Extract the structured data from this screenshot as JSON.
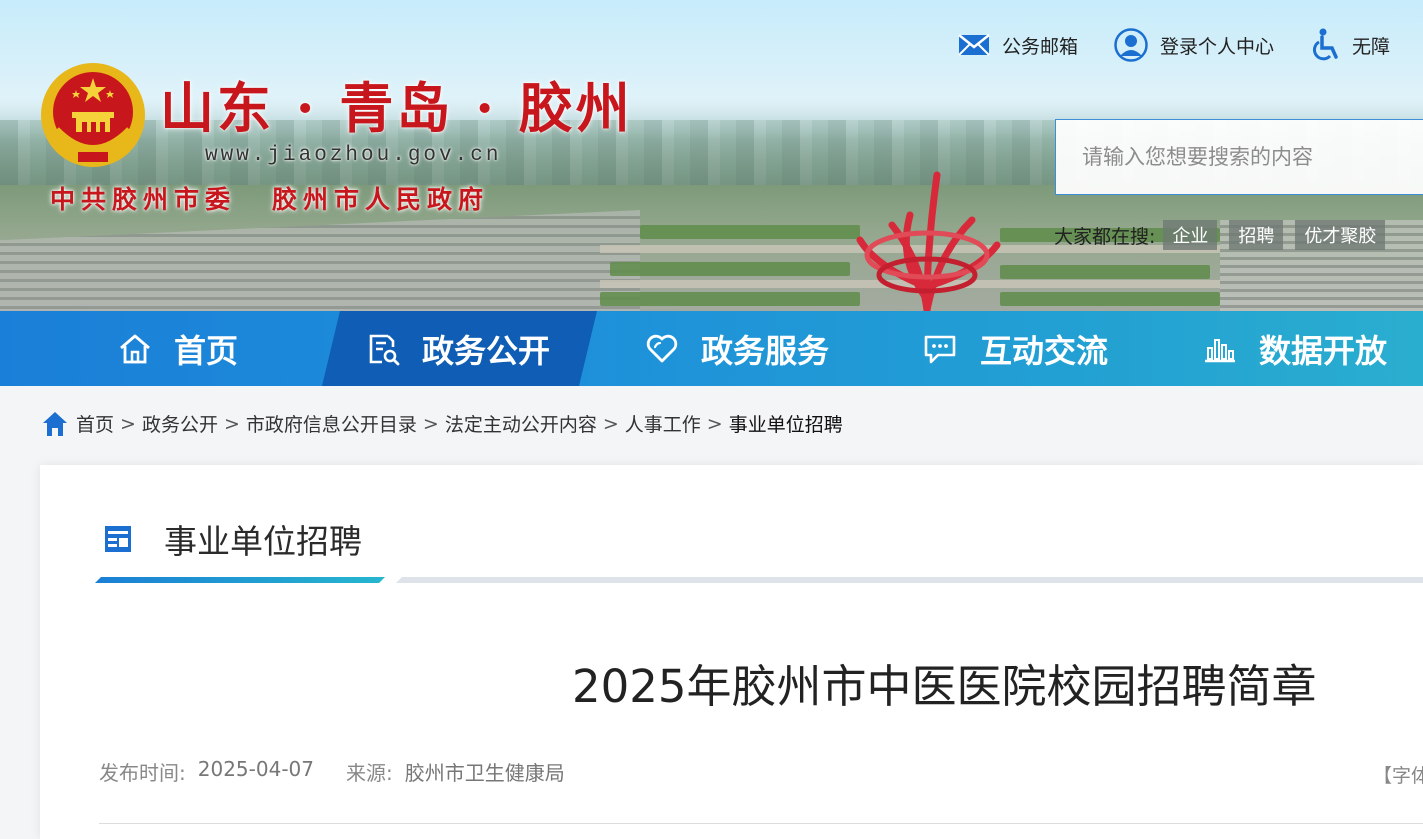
{
  "site": {
    "title": "山东 · 青岛 · 胶州",
    "url": "www.jiaozhou.gov.cn",
    "sub_left": "中共胶州市委",
    "sub_right": "胶州市人民政府"
  },
  "toplinks": [
    {
      "label": "公务邮箱",
      "icon": "envelope-icon"
    },
    {
      "label": "登录个人中心",
      "icon": "user-icon"
    },
    {
      "label": "无障",
      "icon": "wheelchair-icon"
    }
  ],
  "search": {
    "placeholder": "请输入您想要搜索的内容"
  },
  "hot": {
    "label": "大家都在搜:",
    "tags": [
      "企业",
      "招聘",
      "优才聚胶"
    ]
  },
  "nav": [
    {
      "label": "首页",
      "icon": "home-icon",
      "active": false
    },
    {
      "label": "政务公开",
      "icon": "document-search-icon",
      "active": true
    },
    {
      "label": "政务服务",
      "icon": "heart-icon",
      "active": false
    },
    {
      "label": "互动交流",
      "icon": "chat-icon",
      "active": false
    },
    {
      "label": "数据开放",
      "icon": "bar-chart-icon",
      "active": false
    }
  ],
  "breadcrumb": {
    "items": [
      "首页",
      "政务公开",
      "市政府信息公开目录",
      "法定主动公开内容",
      "人事工作"
    ],
    "current": "事业单位招聘",
    "separator": ">"
  },
  "section": {
    "title": "事业单位招聘"
  },
  "article": {
    "title": "2025年胶州市中医医院校园招聘简章",
    "publish_label": "发布时间:",
    "publish_date": "2025-04-07",
    "source_label": "来源:",
    "source": "胶州市卫生健康局",
    "font_size_label": "【字体"
  },
  "colors": {
    "nav_bg": "#1e90da",
    "nav_active": "#0f5db4",
    "brand_red": "#c8161d",
    "accent_blue": "#1b7fd4"
  }
}
